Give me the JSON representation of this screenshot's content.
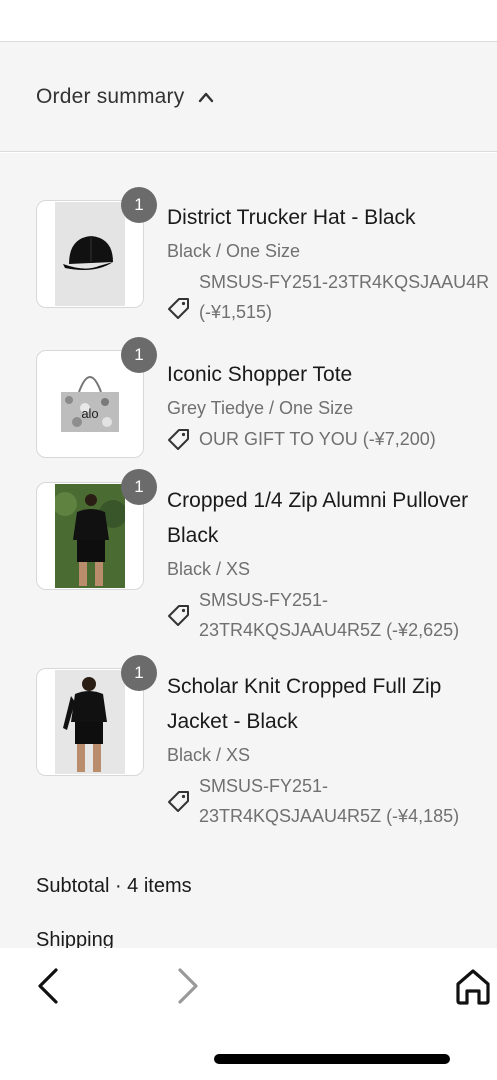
{
  "summary": {
    "title": "Order summary",
    "toggle_icon": "chevron-up-icon"
  },
  "items": [
    {
      "quantity": "1",
      "name_lines": [
        "District Trucker Hat - Black"
      ],
      "variant": "Black / One Size",
      "discount_lines": [
        "SMSUS-FY251-23TR4KQSJAAU4R",
        "(-¥1,515)"
      ],
      "thumbnail": "black-trucker-hat"
    },
    {
      "quantity": "1",
      "name_lines": [
        "Iconic Shopper Tote"
      ],
      "variant": "Grey Tiedye / One Size",
      "discount_lines": [
        "OUR GIFT TO YOU (-¥7,200)"
      ],
      "thumbnail": "grey-tiedye-tote-bag"
    },
    {
      "quantity": "1",
      "name_lines": [
        "Cropped 1/4 Zip Alumni Pullover",
        "Black"
      ],
      "variant": "Black / XS",
      "discount_lines": [
        "SMSUS-FY251-",
        "23TR4KQSJAAU4R5Z (-¥2,625)"
      ],
      "thumbnail": "model-black-pullover"
    },
    {
      "quantity": "1",
      "name_lines": [
        "Scholar Knit Cropped Full Zip",
        "Jacket - Black"
      ],
      "variant": "Black / XS",
      "discount_lines": [
        "SMSUS-FY251-",
        "23TR4KQSJAAU4R5Z (-¥4,185)"
      ],
      "thumbnail": "model-black-jacket"
    }
  ],
  "totals": {
    "subtotal_label": "Subtotal · 4 items",
    "shipping_label": "Shipping"
  },
  "browser_nav": {
    "back_icon": "chevron-left-icon",
    "forward_icon": "chevron-right-icon",
    "home_icon": "home-icon"
  },
  "colors": {
    "background": "#f5f5f5",
    "badge": "#6b6b6b",
    "muted_text": "#707070",
    "forward_disabled": "#9a9a9a"
  }
}
